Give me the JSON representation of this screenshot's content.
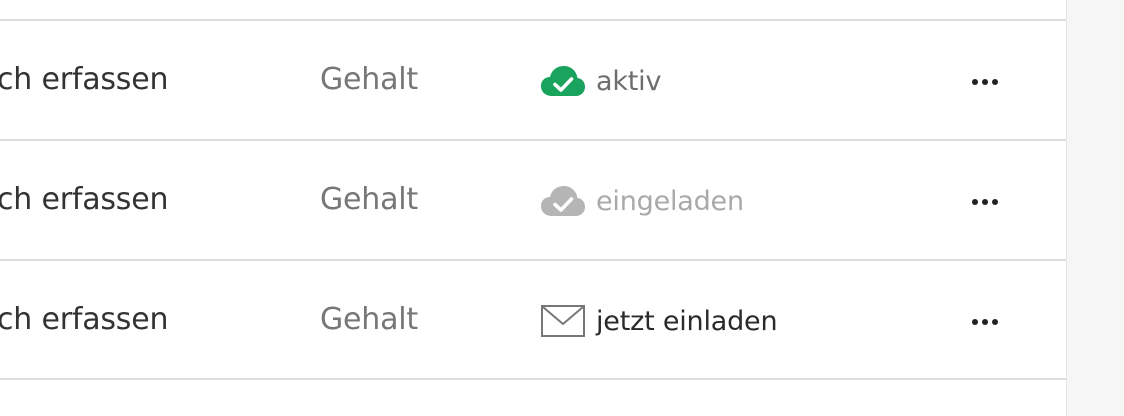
{
  "rows": [
    {
      "name": "ch erfassen",
      "type": "Gehalt",
      "status_text": "aktiv",
      "status_icon": "cloud-check-icon",
      "status_color": "#1aa35c"
    },
    {
      "name": "ch erfassen",
      "type": "Gehalt",
      "status_text": "eingeladen",
      "status_icon": "cloud-check-icon",
      "status_color": "#b5b5b5"
    },
    {
      "name": "ch erfassen",
      "type": "Gehalt",
      "status_text": "jetzt einladen",
      "status_icon": "envelope-icon",
      "status_color": "#777777"
    }
  ],
  "more_icon": "more-options-icon"
}
